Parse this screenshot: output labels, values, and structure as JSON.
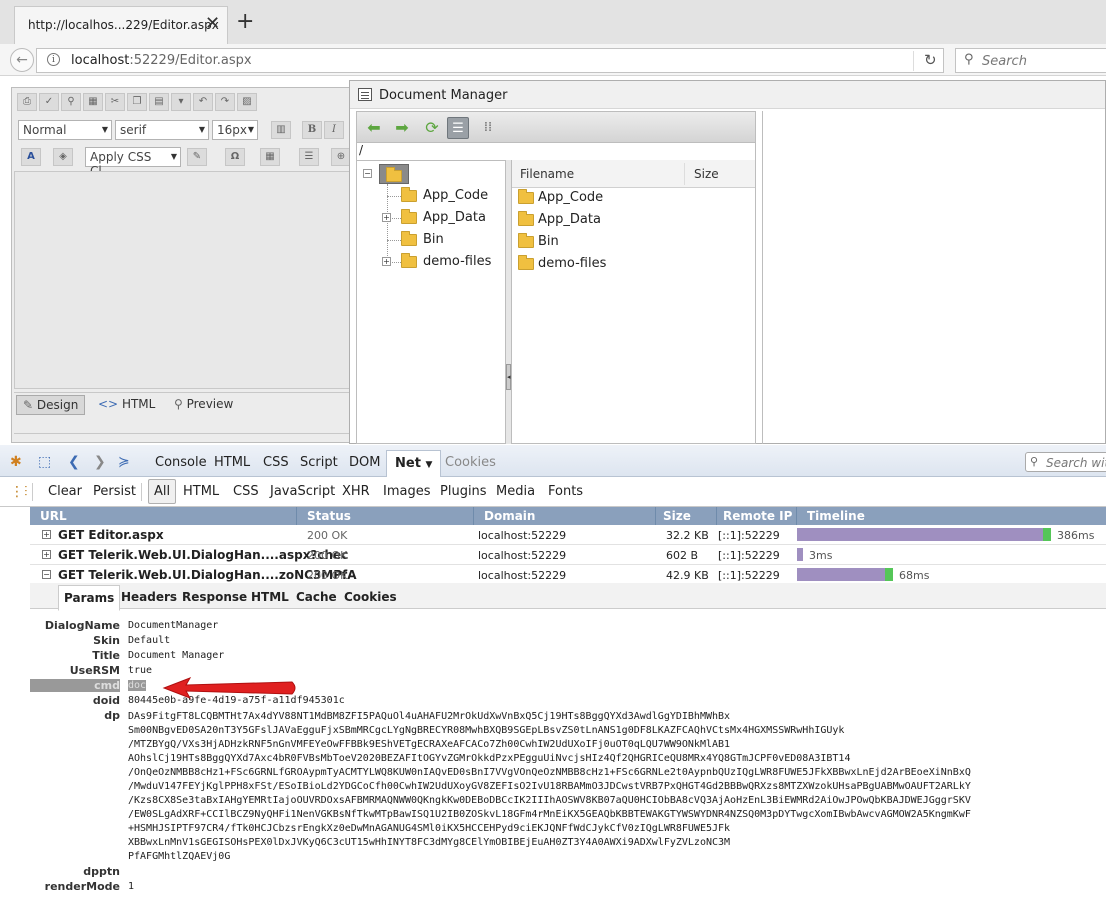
{
  "browser": {
    "tab_title": "http://localhos...229/Editor.aspx",
    "tab_close": "✕",
    "new_tab": "+",
    "url_host": "localhost",
    "url_rest": ":52229/Editor.aspx",
    "search_placeholder": "Search"
  },
  "editor": {
    "format_select": "Normal",
    "font_select": "serif",
    "size_select": "16px",
    "css_select": "Apply CSS Cl...",
    "modes": [
      "Design",
      "HTML",
      "Preview"
    ]
  },
  "document_manager": {
    "title": "Document Manager",
    "path": "/",
    "tree_items": [
      "App_Code",
      "App_Data",
      "Bin",
      "demo-files"
    ],
    "grid_headers": {
      "filename": "Filename",
      "size": "Size"
    },
    "grid_items": [
      "App_Code",
      "App_Data",
      "Bin",
      "demo-files"
    ]
  },
  "firebug": {
    "tabs": [
      "Console",
      "HTML",
      "CSS",
      "Script",
      "DOM",
      "Net",
      "Cookies"
    ],
    "active_tab": "Net",
    "search_placeholder": "Search with",
    "filters": [
      "Clear",
      "Persist",
      "All",
      "HTML",
      "CSS",
      "JavaScript",
      "XHR",
      "Images",
      "Plugins",
      "Media",
      "Fonts"
    ],
    "columns": [
      "URL",
      "Status",
      "Domain",
      "Size",
      "Remote IP",
      "Timeline"
    ],
    "requests": [
      {
        "url": "GET Editor.aspx",
        "status": "200 OK",
        "domain": "localhost:52229",
        "size": "32.2 KB",
        "ip": "[::1]:52229",
        "time": "386ms",
        "bar_start": 0.0,
        "bar_fraction": 0.82,
        "expander": "+"
      },
      {
        "url": "GET Telerik.Web.UI.DialogHan....aspx?chec",
        "status": "200 OK",
        "domain": "localhost:52229",
        "size": "602 B",
        "ip": "[::1]:52229",
        "time": "3ms",
        "bar_start": 0.0,
        "bar_fraction": 0.02,
        "expander": "+"
      },
      {
        "url": "GET Telerik.Web.UI.DialogHan....zoNC3MPfA",
        "status": "200 OK",
        "domain": "localhost:52229",
        "size": "42.9 KB",
        "ip": "[::1]:52229",
        "time": "68ms",
        "bar_start": 0.0,
        "bar_fraction": 0.31,
        "expander": "−"
      }
    ],
    "detail_tabs": [
      "Params",
      "Headers",
      "Response",
      "HTML",
      "Cache",
      "Cookies"
    ],
    "params": [
      {
        "name": "DialogName",
        "value": "DocumentManager"
      },
      {
        "name": "Skin",
        "value": "Default"
      },
      {
        "name": "Title",
        "value": "Document Manager"
      },
      {
        "name": "UseRSM",
        "value": "true"
      },
      {
        "name": "cmd",
        "value": "doc"
      },
      {
        "name": "doid",
        "value": "80445e0b-a9fe-4d19-a75f-a11df945301c"
      }
    ],
    "dp_name": "dp",
    "dp_lines": [
      "DAs9FitgFT8LCQBMTHt7Ax4dYV88NT1MdBM8ZFI5PAQuOl4uAHAFU2MrOkUdXwVnBxQ5Cj19HTs8BggQYXd3AwdlGgYDIBhMWhBx",
      "Sm00NBgvED0SA20nT3Y5GFslJAVaEgguFjxSBmMRCgcLYgNgBRECYR08MwhBXQB9SGEpLBsvZS0tLnANS1g0DF8LKAZFCAQhVCtsMx4HGXMSSWRwHhIGUyk",
      "/MTZBYgQ/VXs3HjADHzkRNF5nGnVMFEYeOwFFBBk9EShVETgECRAXeAFCACo7Zh00CwhIW2UdUXoIFj0uOT0qLQU7WW9ONkMlAB1",
      "AOhslCj19HTs8BggQYXd7Axc4bR0FVBsMbToeV2020BEZAFItOGYvZGMrOkkdPzxPEgguUiNvcjsHIz4Qf2QHGRICeQU8MRx4YQ8GTmJCPF0vED08A3IBT14",
      "/OnQeOzNMBB8cHz1+FSc6GRNLfGROAypmTyACMTYLWQ8KUW0nIAQvED0sBnI7VVgVOnQeOzNMBB8cHz1+FSc6GRNLe2t0AypnbQUzIQgLWR8FUWE5JFkXBBwxLnEjd2ArBEoeXiNnBxQ",
      "/MwduV147FEYjKglPPH8xFSt/ESoIBioLd2YDGCoCfh00CwhIW2UdUXoyGV8ZEFIsO2IvU18RBAMmO3JDCwstVRB7PxQHGT4Gd2BBBwQRXzs8MTZXWzokUHsaPBgUABMwOAUFT2ARLkY",
      "/Kzs8CX8Se3taBxIAHgYEMRtIajoOUVRDOxsAFBMRMAQNWW0QKngkKw0DEBoDBCcIK2IIIhAOSWV8KB07aQU0HCIObBA8cVQ3AjAoHzEnL3BiEWMRd2AiOwJPOwQbKBAJDWEJGggrSKV",
      "/EW0SLgAdXRF+CCIlBCZ9NyQHFi1NenVGKBsNfTkwMTpBawISQ1U2IB0ZOSkvL18GFm4rMnEiKX5GEAQbKBBTEWAKGTYWSWYDNR4NZSQ0M3pDYTwgcXomIBwbAwcvAGMOW2A5KngmKwF",
      "+HSMHJSIPTF97CR4/fTk0HCJCbzsrEngkXz0eDwMnAGANUG4SMl0iKX5HCCEHPyd9ciEKJQNFfWdCJykCfV0zIQgLWR8FUWE5JFk",
      "XBBwxLnMnV1sGEGISOHsPEX0lDxJVKyQ6C3cUT15wHhINYT8FC3dMYg8CElYmOBIBEjEuAH0ZT3Y4A0AWXi9ADXwlFyZVLzoNC3M",
      "PfAFGMhtlZQAEVj0G"
    ],
    "tail_params": [
      {
        "name": "dpptn",
        "value": ""
      },
      {
        "name": "renderMode",
        "value": "1"
      }
    ]
  }
}
